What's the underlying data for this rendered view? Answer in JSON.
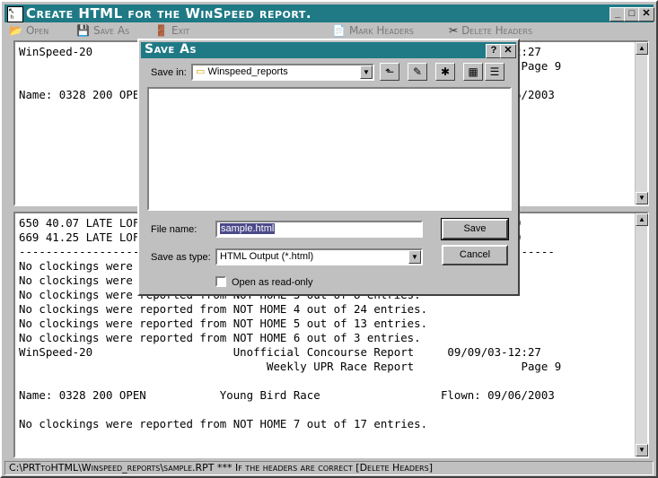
{
  "window": {
    "title": "Create HTML for the WinSpeed report.",
    "buttons": {
      "minimize": "_",
      "maximize": "□",
      "close": "✕"
    }
  },
  "toolbar": {
    "open": "Open",
    "save_as": "Save As",
    "exit": "Exit",
    "mark_headers": "Mark Headers",
    "delete_headers": "Delete Headers"
  },
  "top_pane": {
    "lines": [
      "WinSpeed-20                     Unofficial Concourse Report     09/09/03-12:27",
      "                                     Weekly UPR Race Report                Page 9",
      "",
      "Name: 0328 200 OPEN           Young Bird Race                  Flown: 09/06/2003"
    ]
  },
  "bottom_pane": {
    "lines": [
      "650 40.07 LATE LOFT                                              2.672    0",
      "669 41.25 LATE LOFT                                              2.974    0",
      "--------------------------------------------------------------------------------",
      "No clockings were reported from NOT HOME 1 out of 10 entries.",
      "No clockings were reported from NOT HOME 2 out of 12 entries.",
      "No clockings were reported from NOT HOME 3 out of 8 entries.",
      "No clockings were reported from NOT HOME 4 out of 24 entries.",
      "No clockings were reported from NOT HOME 5 out of 13 entries.",
      "No clockings were reported from NOT HOME 6 out of 3 entries.",
      "WinSpeed-20                     Unofficial Concourse Report     09/09/03-12:27",
      "                                     Weekly UPR Race Report                Page 9",
      "",
      "Name: 0328 200 OPEN           Young Bird Race                  Flown: 09/06/2003",
      "",
      "No clockings were reported from NOT HOME 7 out of 17 entries."
    ]
  },
  "status": "C:\\PRTtoHTML\\Winspeed_reports\\sample.RPT   *** If the headers are correct [Delete Headers]",
  "dialog": {
    "title": "Save As",
    "help": "?",
    "close": "✕",
    "save_in_label": "Save in:",
    "save_in_value": "Winspeed_reports",
    "file_name_label": "File name:",
    "file_name_value": "sample.html",
    "save_as_type_label": "Save as type:",
    "save_as_type_value": "HTML Output (*.html)",
    "open_readonly_label": "Open as read-only",
    "save_button": "Save",
    "cancel_button": "Cancel"
  }
}
